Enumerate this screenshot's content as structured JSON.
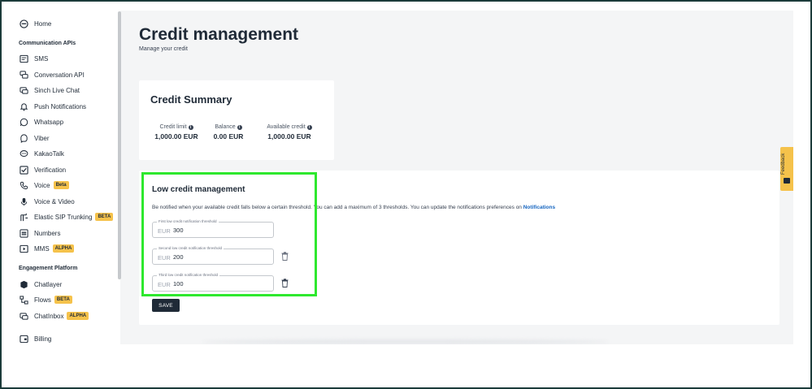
{
  "sidebar": {
    "home": "Home",
    "section_communication": "Communication APIs",
    "communication_items": [
      {
        "label": "SMS",
        "icon": "sms-icon",
        "badge": ""
      },
      {
        "label": "Conversation API",
        "icon": "conversation-icon",
        "badge": ""
      },
      {
        "label": "Sinch Live Chat",
        "icon": "live-chat-icon",
        "badge": ""
      },
      {
        "label": "Push Notifications",
        "icon": "bell-icon",
        "badge": ""
      },
      {
        "label": "Whatsapp",
        "icon": "whatsapp-icon",
        "badge": ""
      },
      {
        "label": "Viber",
        "icon": "viber-icon",
        "badge": ""
      },
      {
        "label": "KakaoTalk",
        "icon": "kakaotalk-icon",
        "badge": ""
      },
      {
        "label": "Verification",
        "icon": "checkbox-icon",
        "badge": ""
      },
      {
        "label": "Voice",
        "icon": "phone-icon",
        "badge": "Beta"
      },
      {
        "label": "Voice & Video",
        "icon": "microphone-icon",
        "badge": ""
      },
      {
        "label": "Elastic SIP Trunking",
        "icon": "sip-icon",
        "badge": "BETA"
      },
      {
        "label": "Numbers",
        "icon": "hash-icon",
        "badge": ""
      },
      {
        "label": "MMS",
        "icon": "mms-icon",
        "badge": "ALPHA"
      }
    ],
    "section_engagement": "Engagement Platform",
    "engagement_items": [
      {
        "label": "Chatlayer",
        "icon": "chatlayer-icon",
        "badge": ""
      },
      {
        "label": "Flows",
        "icon": "flows-icon",
        "badge": "BETA"
      },
      {
        "label": "ChatInbox",
        "icon": "inbox-icon",
        "badge": "ALPHA"
      }
    ],
    "billing": "Billing"
  },
  "page": {
    "title": "Credit management",
    "subtitle": "Manage your credit"
  },
  "summary": {
    "title": "Credit Summary",
    "credit_limit_label": "Credit limit",
    "credit_limit_value": "1,000.00 EUR",
    "balance_label": "Balance",
    "balance_value": "0.00 EUR",
    "available_label": "Available credit",
    "available_value": "1,000.00 EUR"
  },
  "low_credit": {
    "title": "Low credit management",
    "description": "Be notified when your available credit falls below a certain threshold. You can add a maximum of 3 thresholds. You can update the notifications preferences on ",
    "notifications_link": "Notifications",
    "fields": [
      {
        "label": "First low credit notification threshold",
        "currency": "EUR",
        "value": "300"
      },
      {
        "label": "Second low credit notification threshold",
        "currency": "EUR",
        "value": "200"
      },
      {
        "label": "Third low credit notification threshold",
        "currency": "EUR",
        "value": "100"
      }
    ],
    "save_label": "SAVE"
  },
  "feedback_label": "Feedback",
  "colors": {
    "highlight": "#2ee82e",
    "badge": "#f5c24b",
    "link": "#1565c0",
    "dark_button": "#1f2a37"
  }
}
